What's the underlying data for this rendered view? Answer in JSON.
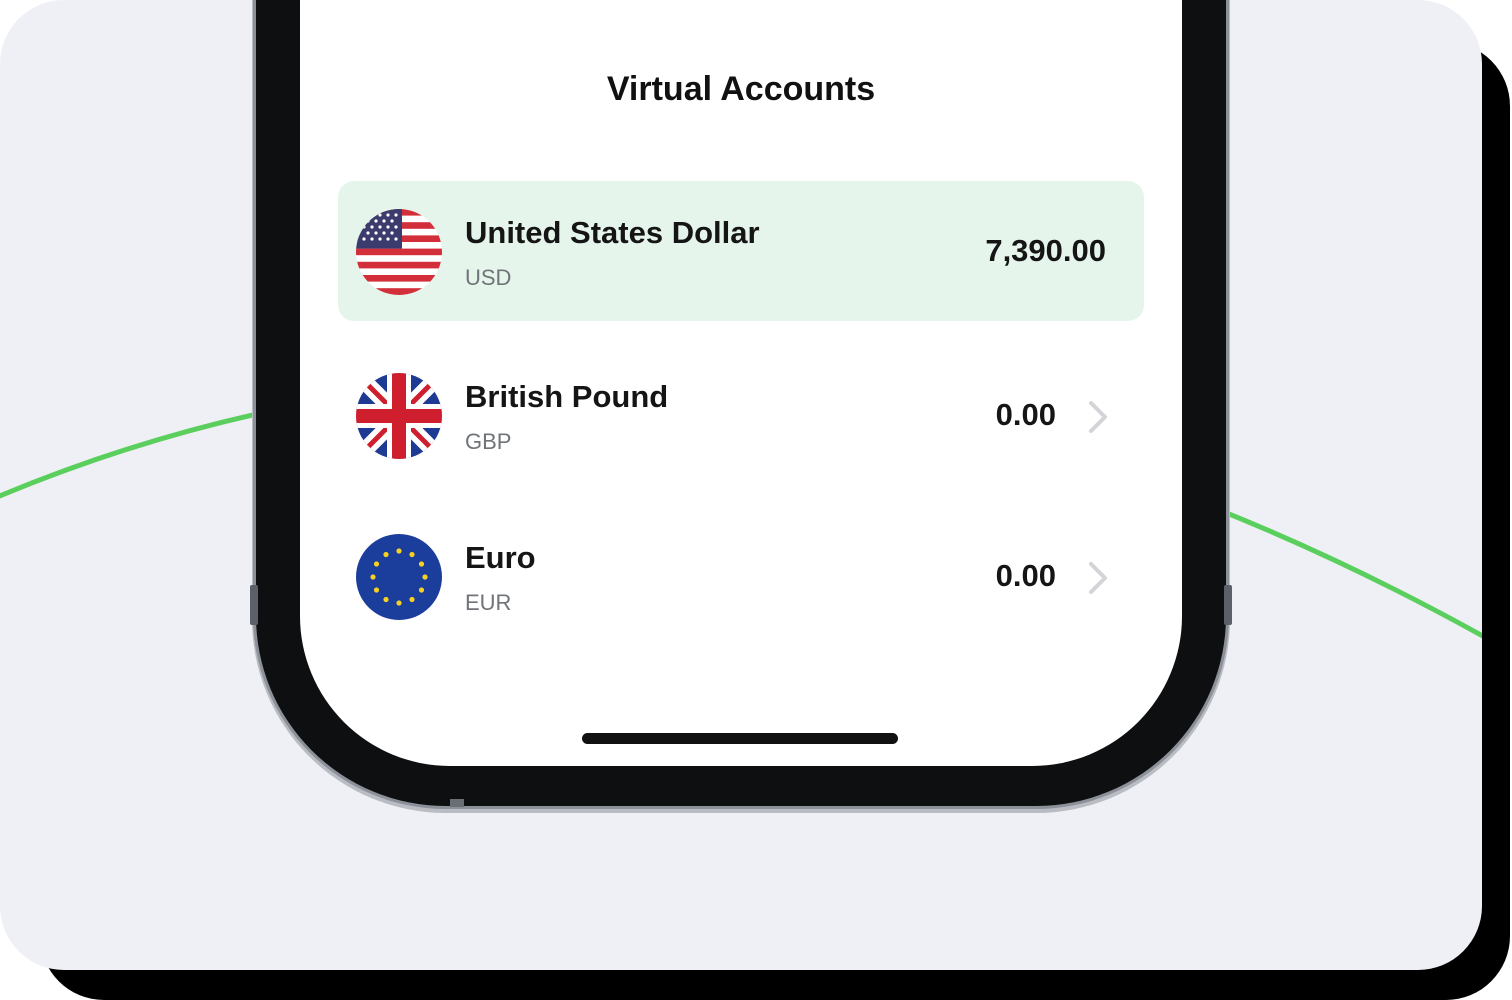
{
  "screen": {
    "title": "Virtual Accounts"
  },
  "accounts": [
    {
      "name": "United States Dollar",
      "code": "USD",
      "balance": "7,390.00",
      "flag_icon": "us-flag-icon",
      "selected": true,
      "has_chevron": false
    },
    {
      "name": "British Pound",
      "code": "GBP",
      "balance": "0.00",
      "flag_icon": "uk-flag-icon",
      "selected": false,
      "has_chevron": true
    },
    {
      "name": "Euro",
      "code": "EUR",
      "balance": "0.00",
      "flag_icon": "eu-flag-icon",
      "selected": false,
      "has_chevron": true
    }
  ],
  "colors": {
    "background": "#eff0f5",
    "accent_curve": "#5bcf5e",
    "selected_row": "#e6f5ec",
    "phone_frame": "#0e0f10",
    "text_primary": "#151515",
    "text_secondary": "#707479",
    "chevron": "#d2d4d8"
  }
}
